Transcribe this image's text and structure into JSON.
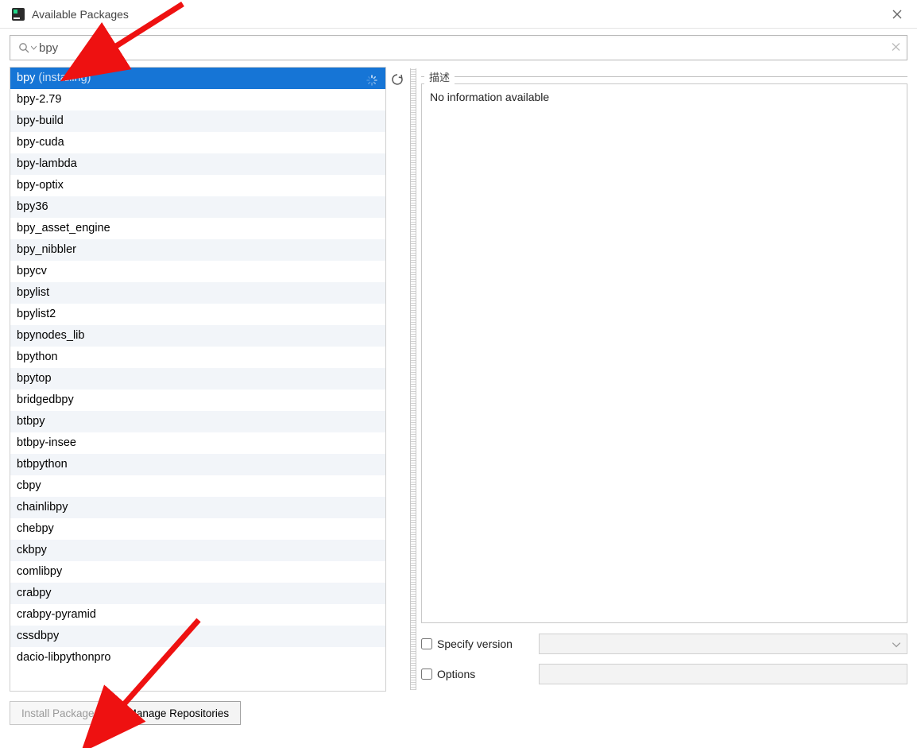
{
  "window": {
    "title": "Available Packages"
  },
  "search": {
    "value": "bpy"
  },
  "packages": [
    {
      "name": "bpy",
      "status": "(installing)",
      "selected": true,
      "busy": true
    },
    {
      "name": "bpy-2.79"
    },
    {
      "name": "bpy-build"
    },
    {
      "name": "bpy-cuda"
    },
    {
      "name": "bpy-lambda"
    },
    {
      "name": "bpy-optix"
    },
    {
      "name": "bpy36"
    },
    {
      "name": "bpy_asset_engine"
    },
    {
      "name": "bpy_nibbler"
    },
    {
      "name": "bpycv"
    },
    {
      "name": "bpylist"
    },
    {
      "name": "bpylist2"
    },
    {
      "name": "bpynodes_lib"
    },
    {
      "name": "bpython"
    },
    {
      "name": "bpytop"
    },
    {
      "name": "bridgedbpy"
    },
    {
      "name": "btbpy"
    },
    {
      "name": "btbpy-insee"
    },
    {
      "name": "btbpython"
    },
    {
      "name": "cbpy"
    },
    {
      "name": "chainlibpy"
    },
    {
      "name": "chebpy"
    },
    {
      "name": "ckbpy"
    },
    {
      "name": "comlibpy"
    },
    {
      "name": "crabpy"
    },
    {
      "name": "crabpy-pyramid"
    },
    {
      "name": "cssdbpy"
    },
    {
      "name": "dacio-libpythonpro"
    }
  ],
  "description": {
    "legend": "描述",
    "body": "No information available"
  },
  "controls": {
    "specify_version_label": "Specify version",
    "specify_version_value": "",
    "specify_version_checked": false,
    "options_label": "Options",
    "options_value": "",
    "options_checked": false
  },
  "footer": {
    "install_label": "Install Package",
    "install_enabled": false,
    "manage_label_pre": "M",
    "manage_label_rest": "anage Repositories"
  }
}
